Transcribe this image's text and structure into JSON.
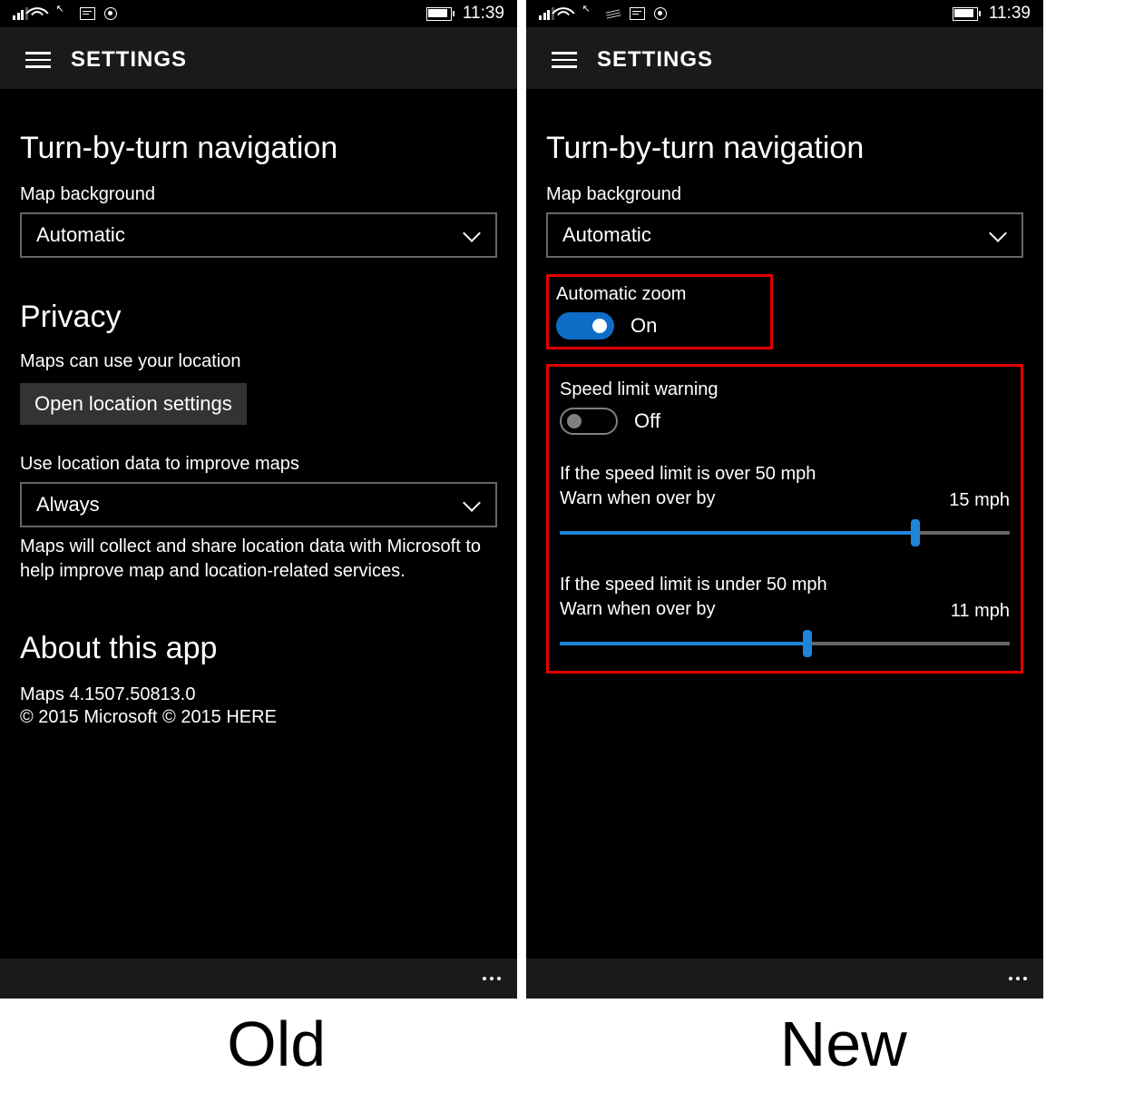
{
  "labels": {
    "old": "Old",
    "new": "New"
  },
  "status": {
    "time": "11:39"
  },
  "header": {
    "title": "SETTINGS"
  },
  "common": {
    "section_title": "Turn-by-turn navigation",
    "map_bg_label": "Map background",
    "map_bg_value": "Automatic"
  },
  "old": {
    "privacy_title": "Privacy",
    "location_label": "Maps can use your location",
    "location_button": "Open location settings",
    "improve_label": "Use location data to improve maps",
    "improve_value": "Always",
    "improve_desc": "Maps will collect and share location data with Microsoft to help improve map and location-related services.",
    "about_title": "About this app",
    "version": "Maps 4.1507.50813.0",
    "copyright": "© 2015 Microsoft © 2015 HERE"
  },
  "new": {
    "auto_zoom_label": "Automatic zoom",
    "auto_zoom_state": "On",
    "speed_label": "Speed limit warning",
    "speed_state": "Off",
    "slider1_line1": "If the speed limit is over 50 mph",
    "slider1_line2": "Warn when over by",
    "slider1_value": "15 mph",
    "slider2_line1": "If the speed limit is under 50 mph",
    "slider2_line2": "Warn when over by",
    "slider2_value": "11 mph"
  }
}
